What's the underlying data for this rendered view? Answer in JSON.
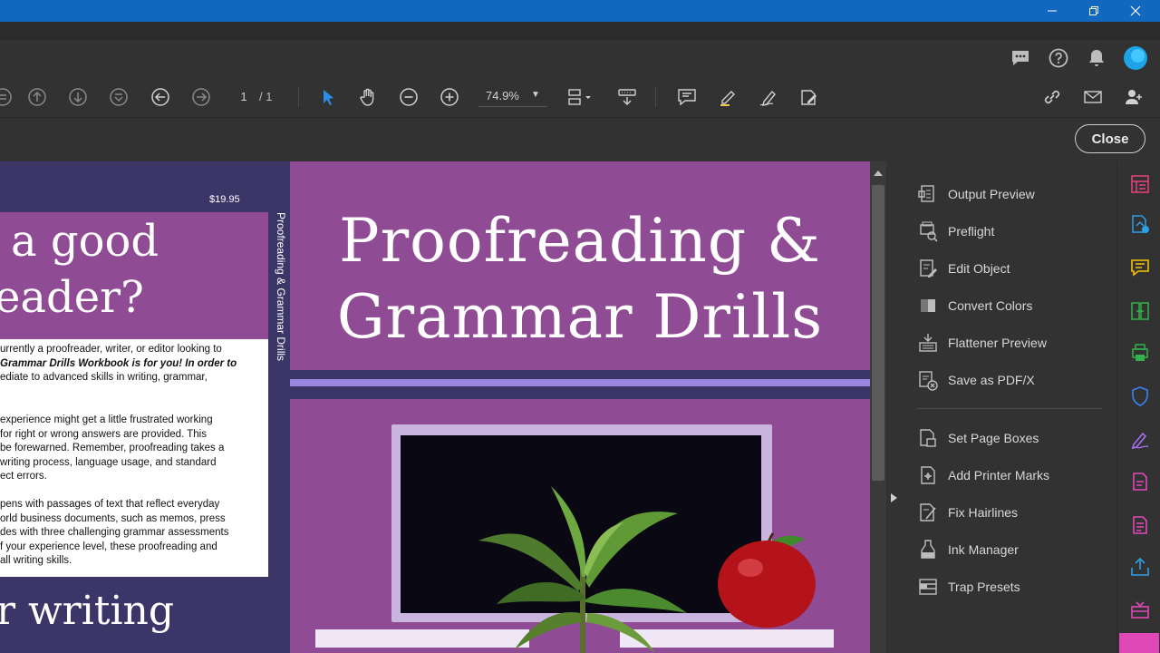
{
  "toolbar": {
    "page_current": "1",
    "page_total": "/ 1",
    "zoom": "74.9%"
  },
  "close_label": "Close",
  "document": {
    "back_cover": {
      "price": "$19.95",
      "headline_line1": "a good",
      "headline_line2": "eader?",
      "paragraph1": [
        "urrently a proofreader, writer, or editor looking to",
        "Grammar Drills Workbook is for you! In order to",
        "ediate to advanced skills in writing, grammar,"
      ],
      "paragraph2": [
        "experience might get a little frustrated working",
        "for right or wrong answers are provided. This",
        "be forewarned. Remember, proofreading takes a",
        "writing process, language usage, and standard",
        "ect errors."
      ],
      "paragraph3": [
        "pens with passages of text that reflect everyday",
        "orld business documents, such as memos, press",
        "des with three challenging grammar assessments",
        "f your experience level, these proofreading and",
        "all writing skills."
      ],
      "bottom_headline": "r writing"
    },
    "spine_text": "Proofreading & Grammar Drills",
    "front_cover": {
      "title_line1": "Proofreading &",
      "title_line2": "Grammar Drills"
    }
  },
  "tools_panel": {
    "group1": [
      {
        "label": "Output Preview",
        "icon": "output-preview-icon"
      },
      {
        "label": "Preflight",
        "icon": "preflight-icon"
      },
      {
        "label": "Edit Object",
        "icon": "edit-object-icon"
      },
      {
        "label": "Convert Colors",
        "icon": "convert-colors-icon"
      },
      {
        "label": "Flattener Preview",
        "icon": "flattener-preview-icon"
      },
      {
        "label": "Save as PDF/X",
        "icon": "save-pdfx-icon"
      }
    ],
    "group2": [
      {
        "label": "Set Page Boxes",
        "icon": "set-page-boxes-icon"
      },
      {
        "label": "Add Printer Marks",
        "icon": "printer-marks-icon"
      },
      {
        "label": "Fix Hairlines",
        "icon": "fix-hairlines-icon"
      },
      {
        "label": "Ink Manager",
        "icon": "ink-manager-icon"
      },
      {
        "label": "Trap Presets",
        "icon": "trap-presets-icon"
      }
    ]
  },
  "colors": {
    "titlebar": "#1268be",
    "accent_blue": "#2d8ceb",
    "cover_purple": "#8f4b94",
    "navy": "#3b3568"
  }
}
